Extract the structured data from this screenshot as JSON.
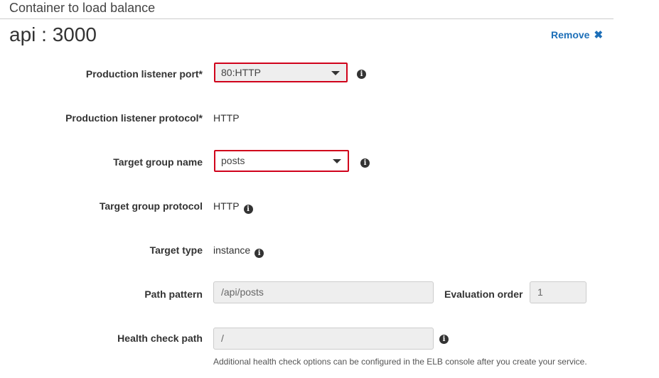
{
  "section": {
    "title": "Container to load balance",
    "container_name": "api : 3000",
    "remove_label": "Remove",
    "remove_icon": "close-icon"
  },
  "form": {
    "listener_port": {
      "label": "Production listener port*",
      "value": "80:HTTP",
      "icon": "info-icon"
    },
    "listener_protocol": {
      "label": "Production listener protocol*",
      "value": "HTTP"
    },
    "target_group_name": {
      "label": "Target group name",
      "value": "posts",
      "icon": "info-icon"
    },
    "target_group_protocol": {
      "label": "Target group protocol",
      "value": "HTTP",
      "icon": "info-icon"
    },
    "target_type": {
      "label": "Target type",
      "value": "instance",
      "icon": "info-icon"
    },
    "path_pattern": {
      "label": "Path pattern",
      "value": "/api/posts"
    },
    "evaluation_order": {
      "label": "Evaluation order",
      "value": "1"
    },
    "health_check_path": {
      "label": "Health check path",
      "value": "/",
      "icon": "info-icon",
      "help": "Additional health check options can be configured in the ELB console after you create your service."
    }
  },
  "colors": {
    "link": "#1d6fb8",
    "highlight_border": "#d0021b",
    "disabled_field": "#eeeeee"
  }
}
